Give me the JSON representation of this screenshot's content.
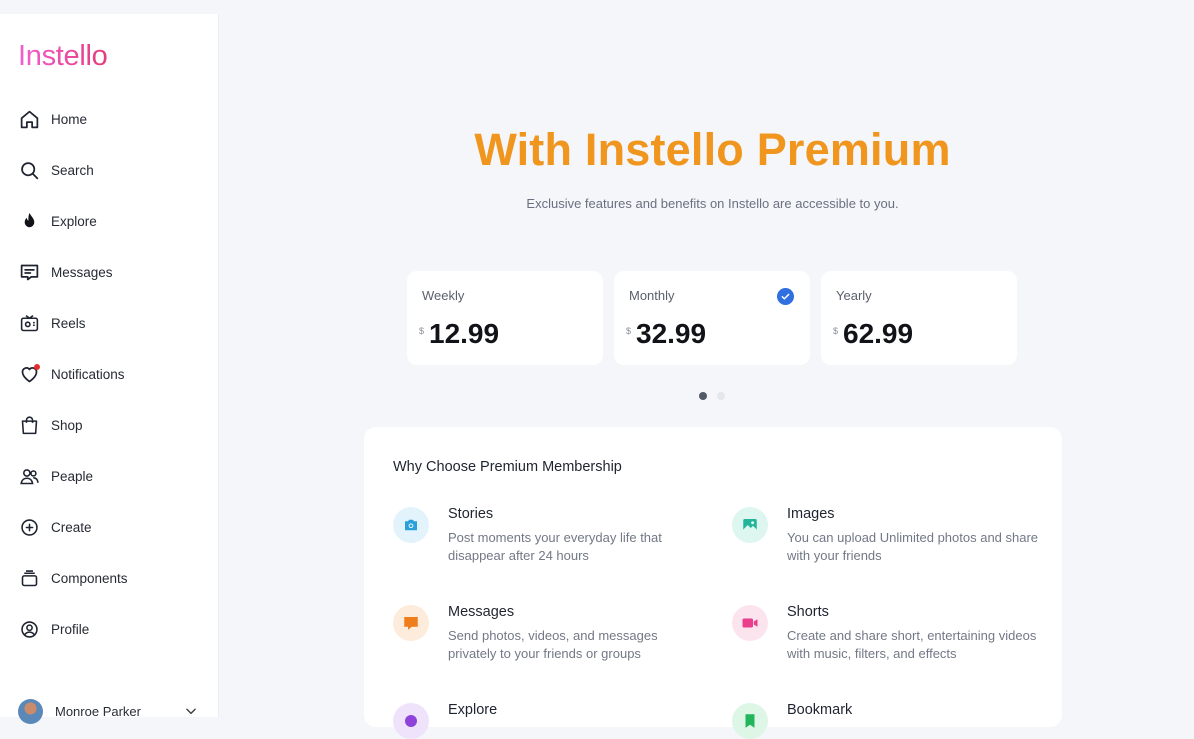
{
  "app": {
    "logo": "Instello"
  },
  "sidebar": {
    "items": [
      {
        "label": "Home",
        "icon": "home-icon"
      },
      {
        "label": "Search",
        "icon": "search-icon"
      },
      {
        "label": "Explore",
        "icon": "flame-icon"
      },
      {
        "label": "Messages",
        "icon": "message-icon"
      },
      {
        "label": "Reels",
        "icon": "reels-icon"
      },
      {
        "label": "Notifications",
        "icon": "heart-icon"
      },
      {
        "label": "Shop",
        "icon": "shopping-bag-icon"
      },
      {
        "label": "Peaple",
        "icon": "people-icon"
      },
      {
        "label": "Create",
        "icon": "plus-circle-icon"
      },
      {
        "label": "Components",
        "icon": "components-icon"
      },
      {
        "label": "Profile",
        "icon": "profile-icon"
      }
    ],
    "user": {
      "name": "Monroe Parker"
    }
  },
  "hero": {
    "title": "With Instello Premium",
    "subtitle": "Exclusive features and benefits on Instello are accessible to you."
  },
  "plans": [
    {
      "name": "Weekly",
      "currency": "$",
      "price": "12.99",
      "selected": false
    },
    {
      "name": "Monthly",
      "currency": "$",
      "price": "32.99",
      "selected": true
    },
    {
      "name": "Yearly",
      "currency": "$",
      "price": "62.99",
      "selected": false
    }
  ],
  "carousel": {
    "pages": 2,
    "active": 1
  },
  "why": {
    "title": "Why Choose Premium Membership",
    "features": [
      {
        "title": "Stories",
        "desc": "Post moments your everyday life that disappear after 24 hours",
        "icon": "camera-icon",
        "color": "#2a9fd8",
        "bg": "#e3f3fc"
      },
      {
        "title": "Images",
        "desc": "You can upload Unlimited photos and share with your friends",
        "icon": "image-icon",
        "color": "#22b59a",
        "bg": "#ddf6f0"
      },
      {
        "title": "Messages",
        "desc": "Send photos, videos, and messages privately to your friends or groups",
        "icon": "chat-icon",
        "color": "#f07d1b",
        "bg": "#fdebdc"
      },
      {
        "title": "Shorts",
        "desc": "Create and share short, entertaining videos with music, filters, and effects",
        "icon": "video-icon",
        "color": "#e83e8c",
        "bg": "#fce4ef"
      },
      {
        "title": "Explore",
        "desc": "",
        "icon": "explore-icon",
        "color": "#8e44d8",
        "bg": "#efe3fb"
      },
      {
        "title": "Bookmark",
        "desc": "",
        "icon": "bookmark-icon",
        "color": "#22b55a",
        "bg": "#ddf6e6"
      }
    ]
  },
  "colors": {
    "accent": "#f0961e",
    "selected": "#2f6fe0",
    "notification": "#e52d2d"
  }
}
